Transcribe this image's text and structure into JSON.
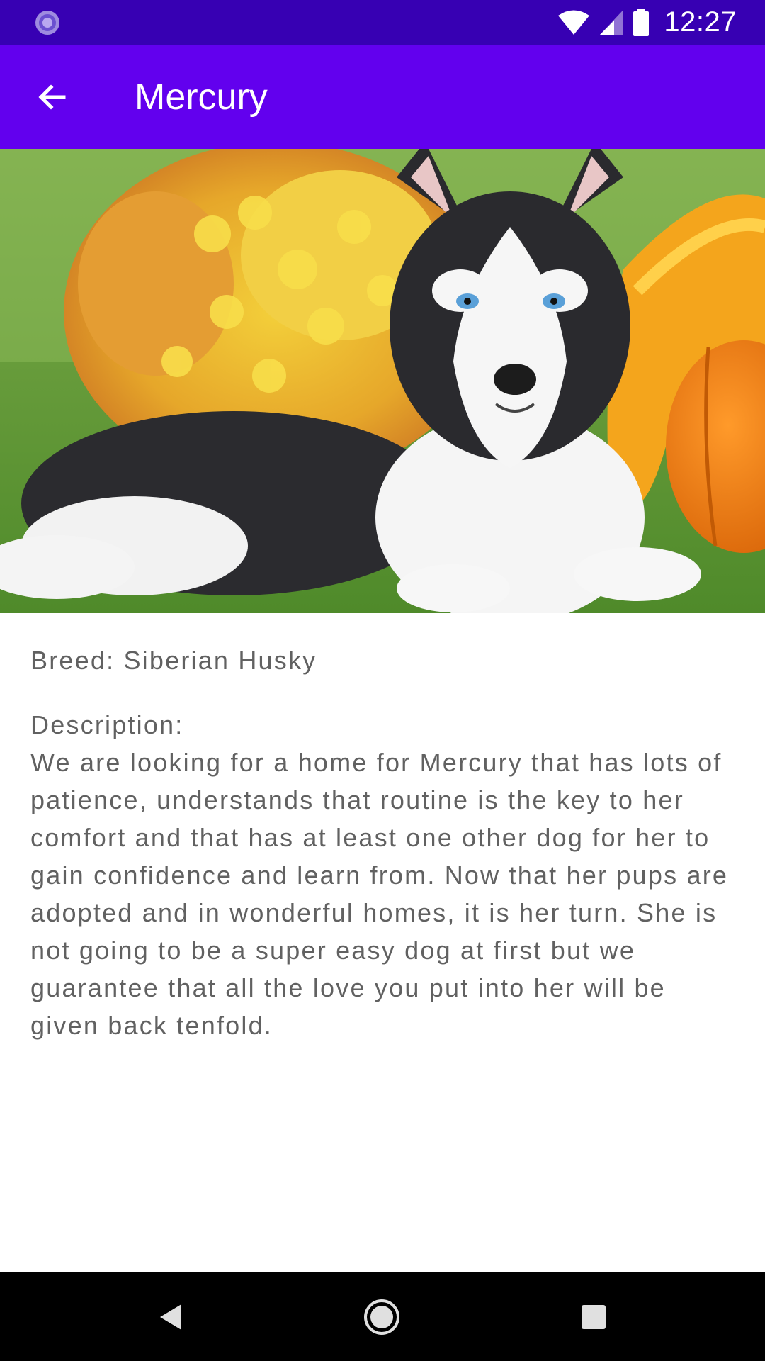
{
  "status_bar": {
    "time": "12:27",
    "icons": [
      "sync-icon",
      "wifi-icon",
      "signal-icon",
      "battery-icon"
    ]
  },
  "app_bar": {
    "title": "Mercury",
    "back_icon": "arrow-back-icon"
  },
  "pet": {
    "photo": "husky-puppy-photo",
    "breed_text": "Breed: Siberian Husky",
    "description_label": "Description:",
    "description": "We are looking for a home for Mercury that has lots of patience, understands that routine is the key to her comfort and that has at least one other dog for her to gain confidence and learn from. Now that her pups are adopted and in wonderful homes, it is her turn. She is not going to be a super easy dog at first but we guarantee that all the love you put into her will be given back tenfold."
  },
  "nav_bar": {
    "buttons": [
      "back-triangle-icon",
      "home-circle-icon",
      "recents-square-icon"
    ]
  },
  "colors": {
    "status_bar": "#3700B3",
    "app_bar": "#6200EE",
    "text": "#616161",
    "nav_bar": "#000000"
  }
}
